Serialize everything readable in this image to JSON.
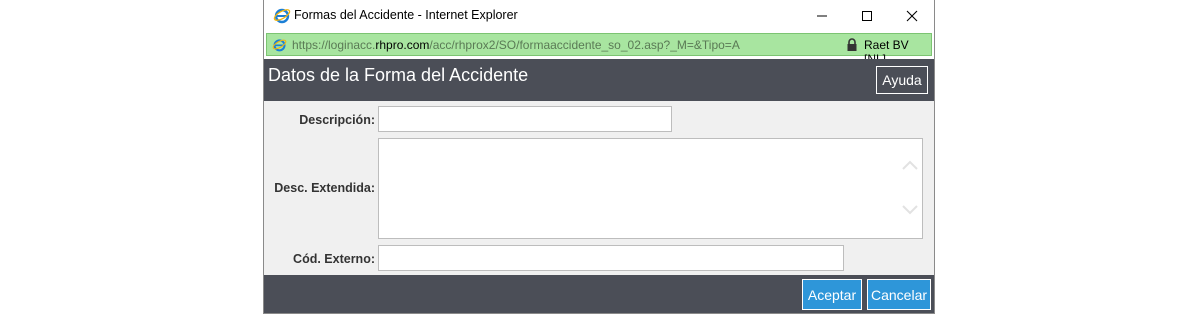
{
  "window": {
    "title": "Formas del Accidente - Internet Explorer"
  },
  "address": {
    "url_prefix": "https://loginacc.",
    "url_domain": "rhpro.com",
    "url_path": "/acc/rhprox2/SO/formaaccidente_so_02.asp?_M=&Tipo=A",
    "certificate": "Raet BV [NL]"
  },
  "header": {
    "title": "Datos de la Forma del Accidente",
    "help_label": "Ayuda"
  },
  "form": {
    "descripcion": {
      "label": "Descripción:",
      "value": ""
    },
    "desc_extendida": {
      "label": "Desc. Extendida:",
      "value": ""
    },
    "cod_externo": {
      "label": "Cód. Externo:",
      "value": ""
    }
  },
  "footer": {
    "accept_label": "Aceptar",
    "cancel_label": "Cancelar"
  },
  "colors": {
    "panel_dark": "#4b4e57",
    "address_green": "#a8e5a0",
    "button_blue": "#2e96d9",
    "content_bg": "#f0f0f0"
  },
  "icons": [
    "ie-icon",
    "minimize-icon",
    "maximize-icon",
    "close-icon",
    "lock-icon",
    "chevron-up-icon",
    "chevron-down-icon"
  ]
}
